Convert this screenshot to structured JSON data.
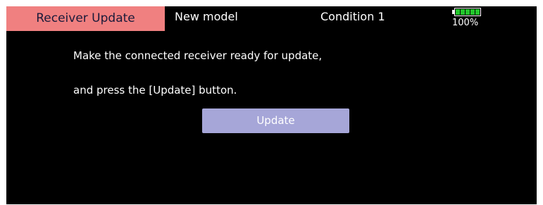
{
  "header": {
    "screen_title": "Receiver Update",
    "model_name": "New model",
    "condition": "Condition 1",
    "battery": {
      "level_percent": 100,
      "label": "100%",
      "icon": "battery-icon",
      "fill_color": "#22c72b"
    }
  },
  "main": {
    "instruction_line_1": "Make the connected receiver ready for update,",
    "instruction_line_2": "and press the [Update] button.",
    "update_button_label": "Update"
  },
  "colors": {
    "title_tab_background": "#f08080",
    "screen_background": "#000000",
    "button_background": "#a6a6d8"
  }
}
